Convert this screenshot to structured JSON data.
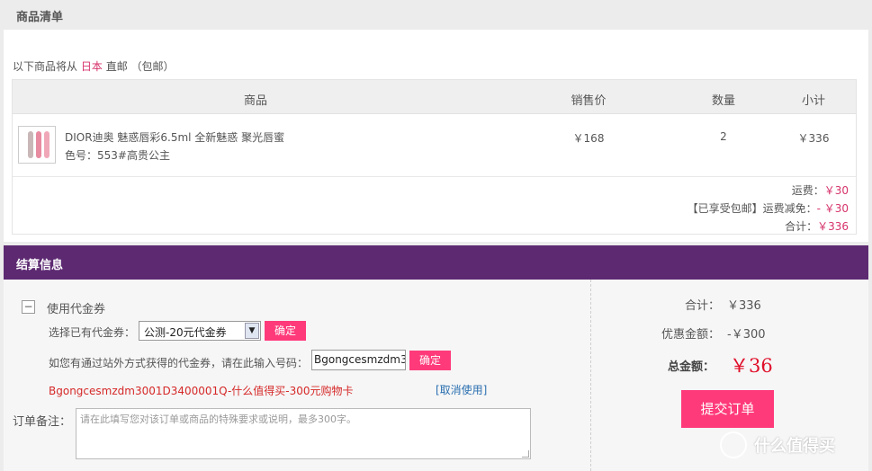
{
  "list": {
    "title": "商品清单",
    "ship_prefix": "以下商品将从",
    "ship_country": "日本",
    "ship_suffix": "直邮",
    "ship_note": "（包邮）",
    "headers": {
      "product": "商品",
      "price": "销售价",
      "qty": "数量",
      "subtotal": "小计"
    },
    "item": {
      "name": "DIOR迪奥 魅惑唇彩6.5ml 全新魅惑 聚光唇蜜",
      "spec": "色号：553#高贵公主",
      "price": "￥168",
      "qty": "2",
      "subtotal": "￥336"
    },
    "fees": {
      "shipping_label": "运费：",
      "shipping_value": "￥30",
      "discount_label": "【已享受包邮】运费减免：",
      "discount_value": "- ￥30",
      "total_label": "合计：",
      "total_value": "￥336"
    }
  },
  "settle": {
    "title": "结算信息",
    "toggle_symbol": "−",
    "coupon_title": "使用代金券",
    "select_label": "选择已有代金券：",
    "select_value": "公测-20元代金券",
    "confirm_label": "确定",
    "code_label": "如您有通过站外方式获得的代金券，请在此输入号码：",
    "code_value": "Bgongcesmzdm3",
    "applied_coupon": "Bgongcesmzdm3001D3400001Q-什么值得买-300元购物卡",
    "cancel_label": "[取消使用]",
    "remark_label": "订单备注：",
    "remark_placeholder": "请在此填写您对该订单或商品的特殊要求或说明，最多300字。"
  },
  "summary": {
    "total_label": "合计：",
    "total_value": "￥336",
    "discount_label": "优惠金额：",
    "discount_value": "-￥300",
    "grand_label": "总金额：",
    "grand_value": "￥36",
    "submit_label": "提交订单"
  },
  "watermark": {
    "text": "什么值得买"
  },
  "colors": {
    "accent_pink": "#ff3a7a",
    "header_purple": "#5d2a72",
    "price_red": "#e0102a"
  }
}
